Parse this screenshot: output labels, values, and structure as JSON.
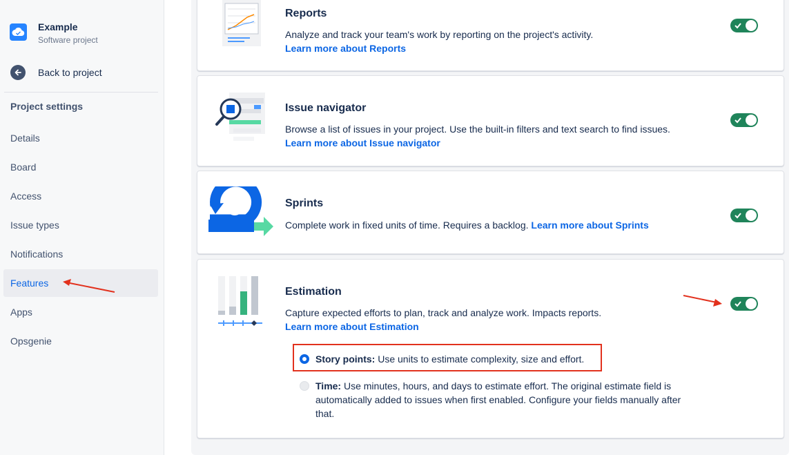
{
  "sidebar": {
    "project_name": "Example",
    "project_type": "Software project",
    "back_label": "Back to project",
    "section_title": "Project settings",
    "items": [
      {
        "label": "Details"
      },
      {
        "label": "Board"
      },
      {
        "label": "Access"
      },
      {
        "label": "Issue types"
      },
      {
        "label": "Notifications"
      },
      {
        "label": "Features",
        "active": true
      },
      {
        "label": "Apps"
      },
      {
        "label": "Opsgenie"
      }
    ]
  },
  "features": [
    {
      "title": "Reports",
      "description": "Analyze and track your team's work by reporting on the project's activity.",
      "link": "Learn more about Reports",
      "enabled": true
    },
    {
      "title": "Issue navigator",
      "description": "Browse a list of issues in your project. Use the built-in filters and text search to find issues.",
      "link": "Learn more about Issue navigator",
      "enabled": true
    },
    {
      "title": "Sprints",
      "description": "Complete work in fixed units of time. Requires a backlog.",
      "link": "Learn more about Sprints",
      "enabled": true
    },
    {
      "title": "Estimation",
      "description": "Capture expected efforts to plan, track and analyze work. Impacts reports.",
      "link": "Learn more about Estimation",
      "enabled": true,
      "options": [
        {
          "label": "Story points:",
          "text": "Use units to estimate complexity, size and effort.",
          "selected": true
        },
        {
          "label": "Time:",
          "text": "Use minutes, hours, and days to estimate effort. The original estimate field is automatically added to issues when first enabled. Configure your fields manually after that.",
          "selected": false
        }
      ]
    }
  ],
  "colors": {
    "accent": "#0c66e4",
    "toggle_on": "#1f845a",
    "annotation": "#e2311d"
  },
  "icons": {
    "project": "cloud-icon",
    "back": "arrow-left-icon",
    "toggle": "check-icon"
  }
}
